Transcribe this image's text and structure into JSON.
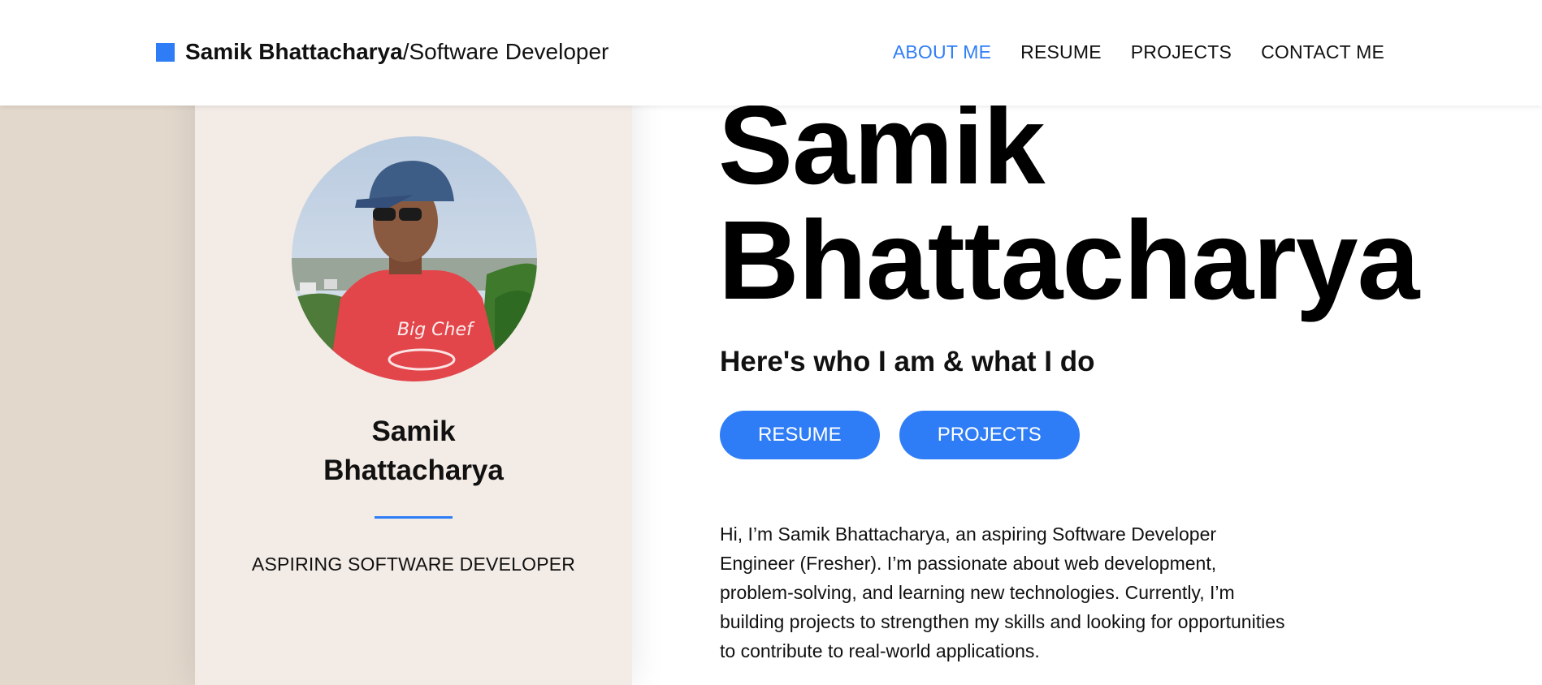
{
  "header": {
    "brand_name": "Samik Bhattacharya",
    "brand_separator": "/",
    "brand_title": "Software Developer",
    "nav": [
      {
        "label": "ABOUT ME",
        "active": true
      },
      {
        "label": "RESUME",
        "active": false
      },
      {
        "label": "PROJECTS",
        "active": false
      },
      {
        "label": "CONTACT ME",
        "active": false
      }
    ]
  },
  "profile_card": {
    "name_line1": "Samik",
    "name_line2": "Bhattacharya",
    "role": "ASPIRING SOFTWARE DEVELOPER"
  },
  "main": {
    "title_line1": "Samik",
    "title_line2": "Bhattacharya",
    "subtitle": "Here's who I am & what I do",
    "buttons": [
      {
        "label": "RESUME"
      },
      {
        "label": "PROJECTS"
      }
    ],
    "intro": "Hi, I’m Samik Bhattacharya, an aspiring Software Developer Engineer (Fresher). I’m passionate about web development, problem-solving, and learning new technologies. Currently, I’m building projects to strengthen my skills and looking for opportunities to contribute to real-world applications."
  },
  "colors": {
    "accent": "#2f7df6",
    "card_bg": "#f3ebe5",
    "strip_bg": "#e2d8cc"
  }
}
